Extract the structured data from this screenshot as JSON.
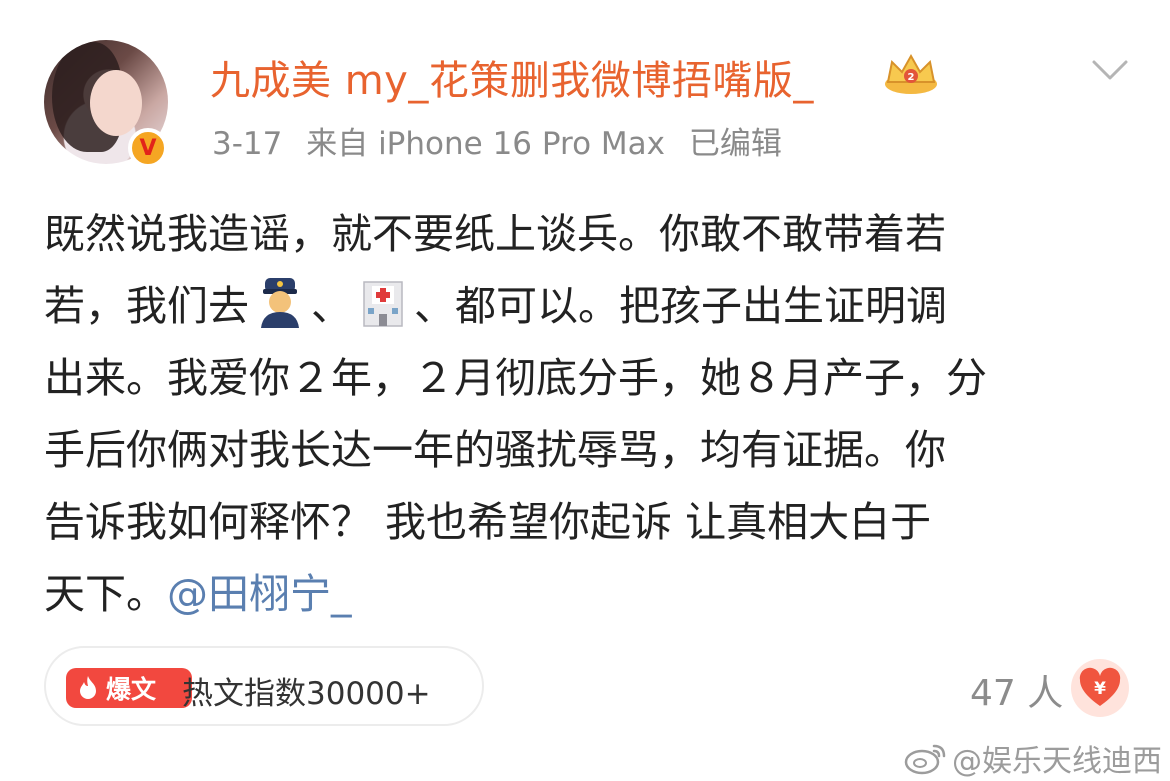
{
  "post": {
    "author": "九成美 my_花策删我微博捂嘴版_",
    "verified_badge": "V",
    "date": "3-17",
    "source": "来自 iPhone 16 Pro Max",
    "edited": "已编辑",
    "content_lines": [
      "既然说我造谣，就不要纸上谈兵。你敢不敢带着若",
      [
        "若，我们去",
        "、",
        "、都可以。把孩子出生证明调"
      ],
      "出来。我爱你２年，２月彻底分手，她８月产子，分",
      "手后你俩对我长达一年的骚扰辱骂，均有证据。你",
      "告诉我如何释怀？ 我也希望你起诉 让真相大白于",
      "天下。"
    ],
    "mention": "@田栩宁_",
    "emojis": [
      "police-officer-emoji",
      "hospital-emoji"
    ]
  },
  "hot": {
    "badge_label": "爆文",
    "text": "热文指数30000+"
  },
  "reward": {
    "count_text": "47 人",
    "icon": "yen-heart-icon"
  },
  "watermark": "@娱乐天线迪西",
  "colors": {
    "username": "#e8632f",
    "mention": "#5a7fb0",
    "hot_badge": "#f2483f",
    "verified": "#f5a623"
  }
}
